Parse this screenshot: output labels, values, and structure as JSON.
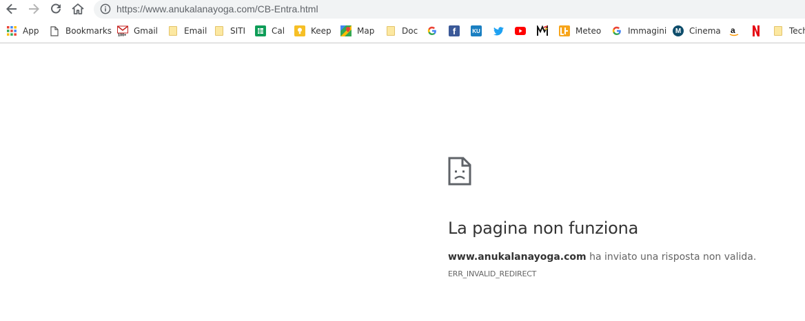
{
  "browser": {
    "url": "https://www.anukalanayoga.com/CB-Entra.html"
  },
  "bookmarks": [
    {
      "label": "App",
      "icon": "apps-grid-icon"
    },
    {
      "label": "Bookmarks",
      "icon": "page-icon"
    },
    {
      "label": "Gmail",
      "icon": "gmail-icon"
    },
    {
      "label": "Email",
      "icon": "folder-icon"
    },
    {
      "label": "SITI",
      "icon": "folder-icon"
    },
    {
      "label": "Cal",
      "icon": "sheets-icon"
    },
    {
      "label": "Keep",
      "icon": "keep-icon"
    },
    {
      "label": "Map",
      "icon": "maps-icon"
    },
    {
      "label": "Doc",
      "icon": "folder-icon"
    },
    {
      "label": "",
      "icon": "google-icon"
    },
    {
      "label": "",
      "icon": "facebook-icon"
    },
    {
      "label": "",
      "icon": "ku-icon"
    },
    {
      "label": "",
      "icon": "twitter-icon"
    },
    {
      "label": "",
      "icon": "youtube-icon"
    },
    {
      "label": "",
      "icon": "m-logo-icon"
    },
    {
      "label": "Meteo",
      "icon": "meteo-icon"
    },
    {
      "label": "Immagini",
      "icon": "google-icon"
    },
    {
      "label": "Cinema",
      "icon": "cinema-icon"
    },
    {
      "label": "",
      "icon": "amazon-icon"
    },
    {
      "label": "",
      "icon": "netflix-icon"
    },
    {
      "label": "Tech",
      "icon": "folder-icon"
    }
  ],
  "error": {
    "title": "La pagina non funziona",
    "domain": "www.anukalanayoga.com",
    "message": " ha inviato una risposta non valida.",
    "code": "ERR_INVALID_REDIRECT"
  },
  "colors": {
    "omnibox_bg": "#f1f3f4",
    "text_dark": "#333333",
    "text_muted": "#646464",
    "folder": "#fce8a1"
  }
}
